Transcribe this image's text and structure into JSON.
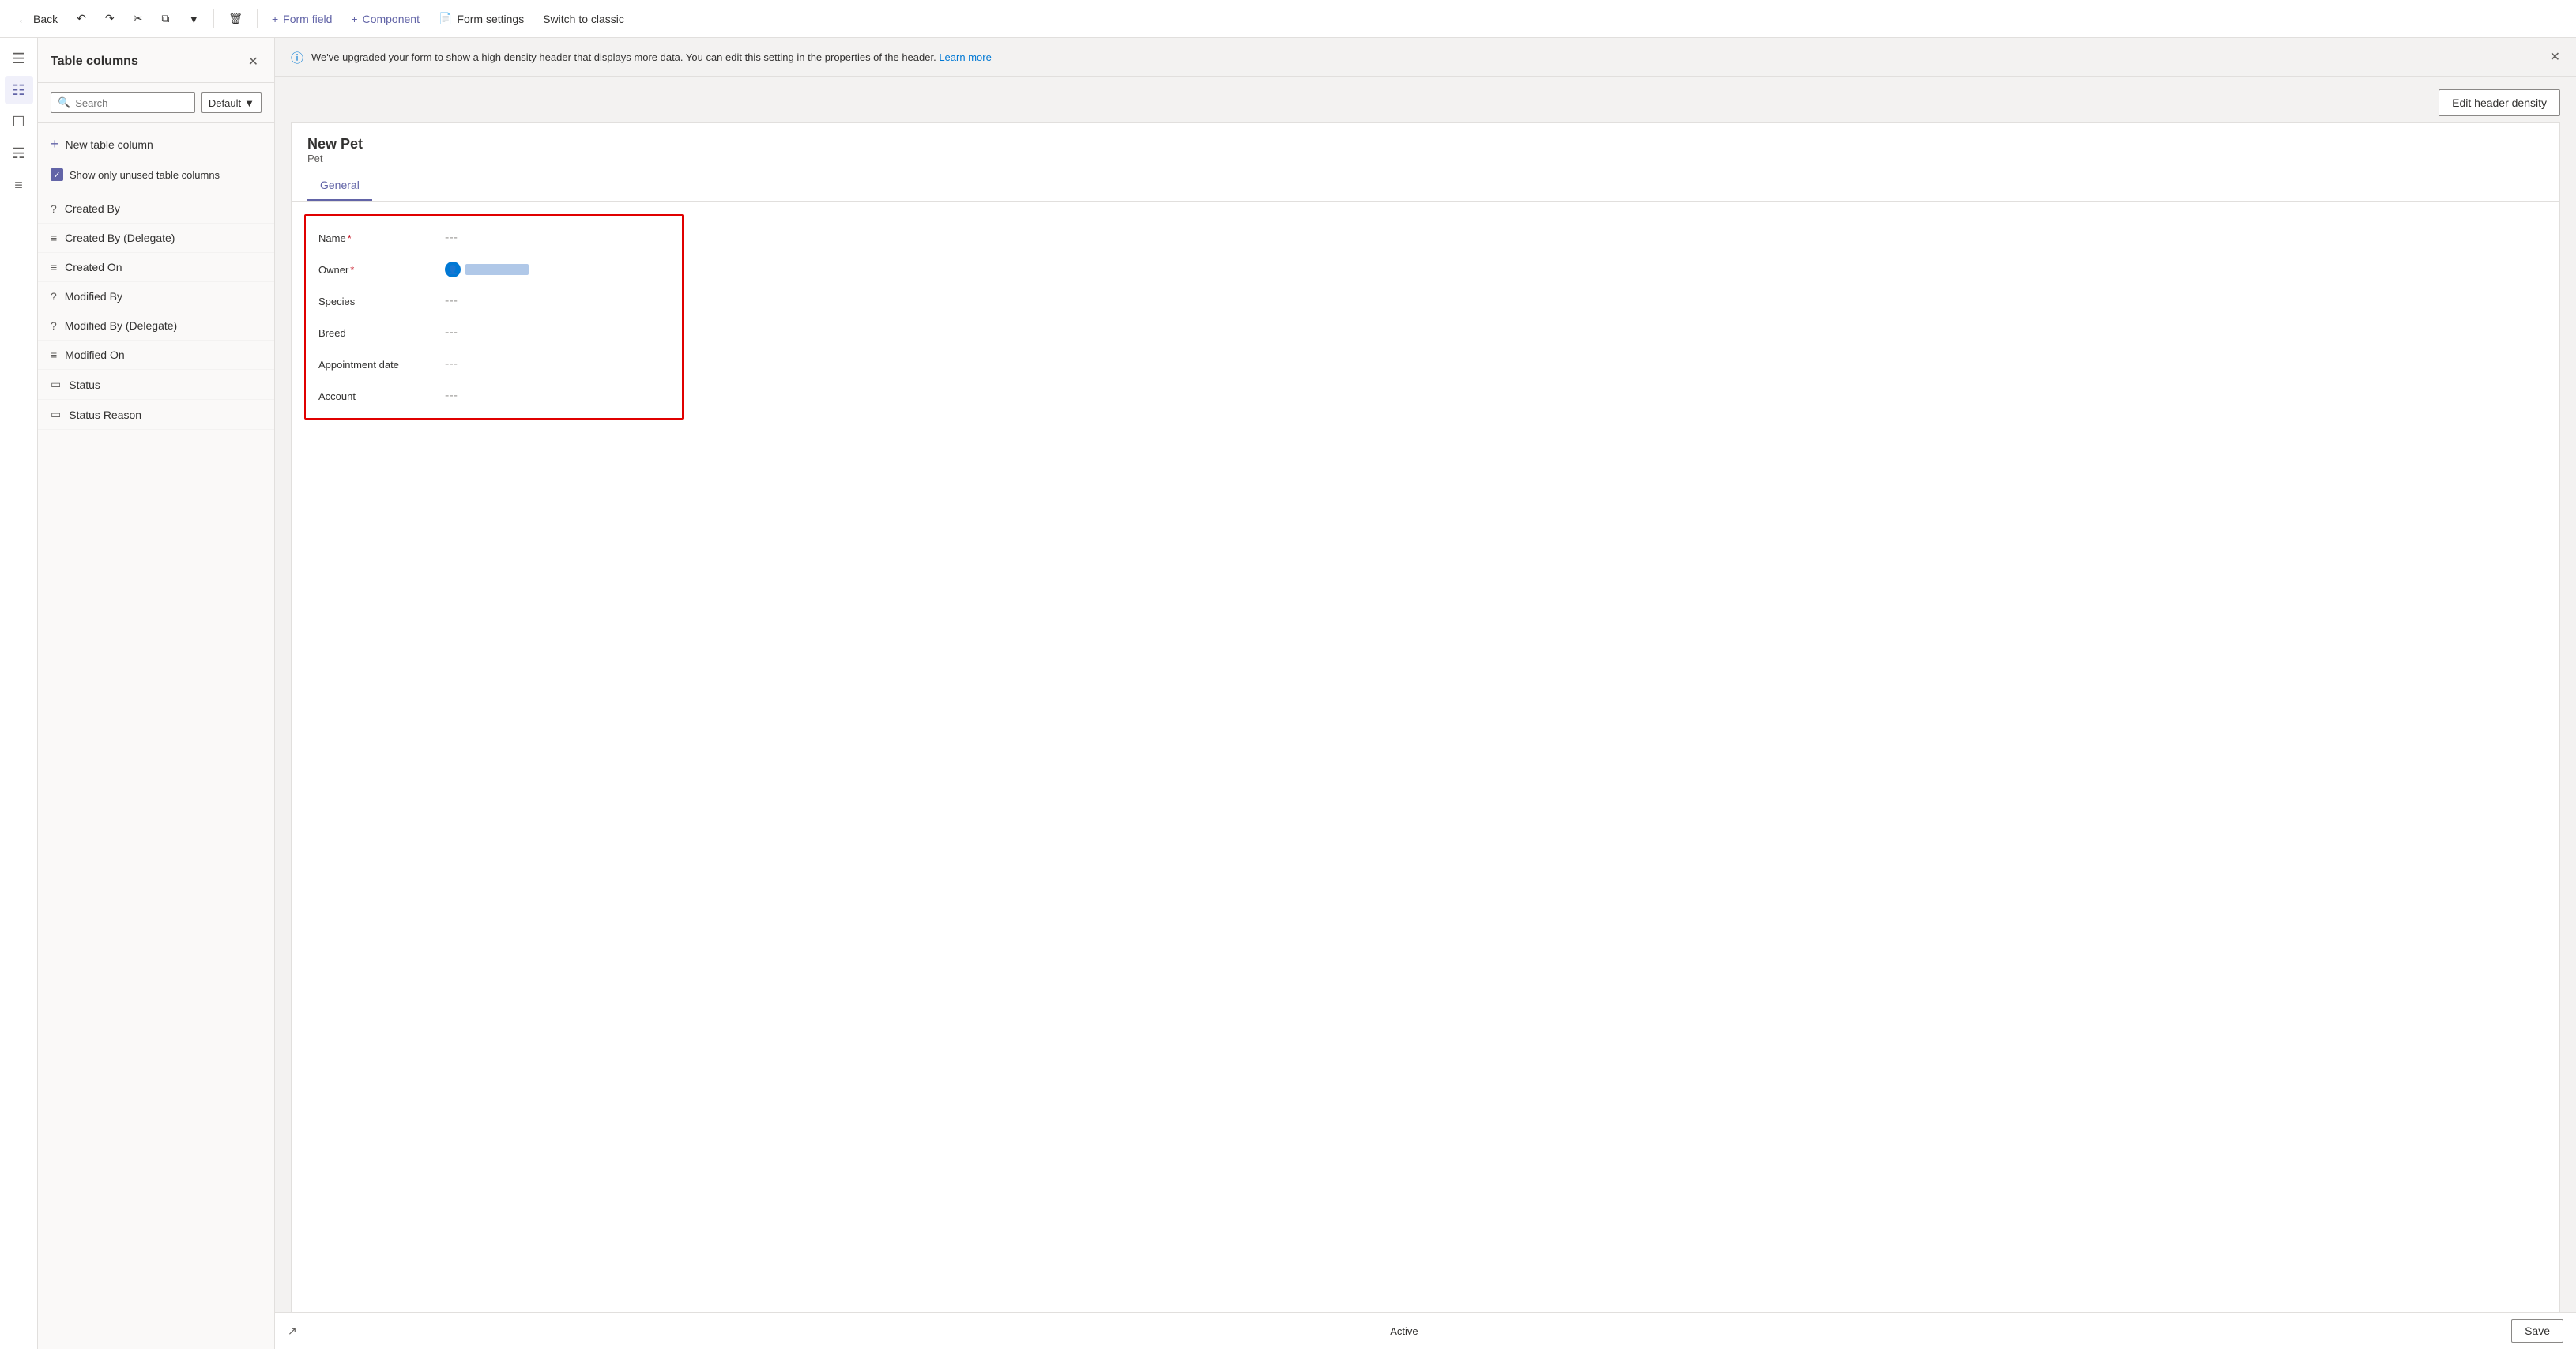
{
  "toolbar": {
    "back_label": "Back",
    "undo_icon": "↩",
    "redo_icon": "↪",
    "cut_icon": "✂",
    "copy_icon": "⧉",
    "more_icon": "▾",
    "delete_icon": "🗑",
    "form_field_label": "Form field",
    "component_label": "Component",
    "form_settings_label": "Form settings",
    "switch_classic_label": "Switch to classic"
  },
  "panel": {
    "title": "Table columns",
    "search_placeholder": "Search",
    "filter_default": "Default",
    "new_column_label": "New table column",
    "show_unused_label": "Show only unused table columns",
    "columns": [
      {
        "id": "created-by",
        "label": "Created By",
        "icon": "?"
      },
      {
        "id": "created-by-delegate",
        "label": "Created By (Delegate)",
        "icon": "≡"
      },
      {
        "id": "created-on",
        "label": "Created On",
        "icon": "≡"
      },
      {
        "id": "modified-by",
        "label": "Modified By",
        "icon": "?"
      },
      {
        "id": "modified-by-delegate",
        "label": "Modified By (Delegate)",
        "icon": "?"
      },
      {
        "id": "modified-on",
        "label": "Modified On",
        "icon": "≡"
      },
      {
        "id": "status",
        "label": "Status",
        "icon": "▭"
      },
      {
        "id": "status-reason",
        "label": "Status Reason",
        "icon": "▭"
      }
    ]
  },
  "info_banner": {
    "text": "We've upgraded your form to show a high density header that displays more data. You can edit this setting in the properties of the header.",
    "link_text": "Learn more"
  },
  "edit_header_btn": "Edit header density",
  "form": {
    "record_name": "New Pet",
    "record_type": "Pet",
    "tabs": [
      {
        "id": "general",
        "label": "General"
      }
    ],
    "fields": [
      {
        "id": "name",
        "label": "Name",
        "required": true,
        "value": "---",
        "type": "text"
      },
      {
        "id": "owner",
        "label": "Owner",
        "required": true,
        "value": "",
        "type": "lookup"
      },
      {
        "id": "species",
        "label": "Species",
        "required": false,
        "value": "---",
        "type": "text"
      },
      {
        "id": "breed",
        "label": "Breed",
        "required": false,
        "value": "---",
        "type": "text"
      },
      {
        "id": "appointment-date",
        "label": "Appointment date",
        "required": false,
        "value": "---",
        "type": "text"
      },
      {
        "id": "account",
        "label": "Account",
        "required": false,
        "value": "---",
        "type": "text"
      }
    ]
  },
  "bottom": {
    "status": "Active",
    "save_label": "Save"
  },
  "colors": {
    "accent": "#6264a7",
    "red": "#e00000",
    "link": "#0078d4"
  }
}
